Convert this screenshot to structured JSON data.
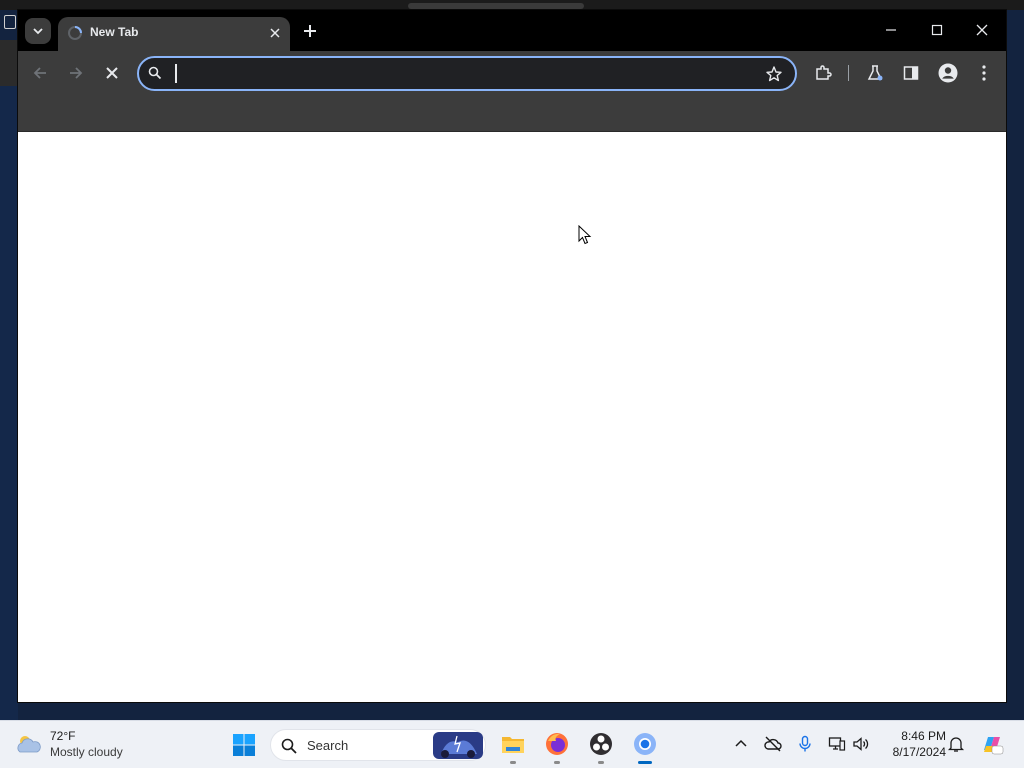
{
  "browser": {
    "tabs": [
      {
        "title": "New Tab",
        "active": true
      }
    ],
    "address_bar": {
      "value": "",
      "placeholder": ""
    },
    "accent": "#8ab4f8"
  },
  "taskbar": {
    "weather": {
      "temperature": "72°F",
      "condition": "Mostly cloudy"
    },
    "search": {
      "label": "Search"
    },
    "clock": {
      "time": "8:46 PM",
      "date": "8/17/2024"
    },
    "apps": [
      "file-explorer",
      "firefox",
      "obs-studio",
      "chrome"
    ],
    "active_app": "chrome"
  }
}
